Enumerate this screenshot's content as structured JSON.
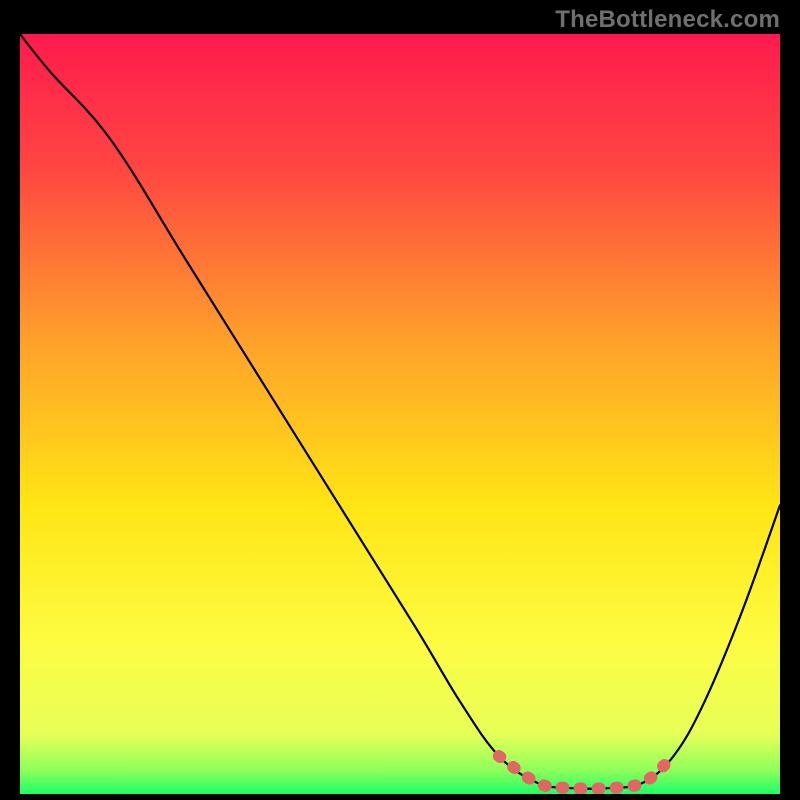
{
  "watermark": "TheBottleneck.com",
  "chart_data": {
    "type": "line",
    "title": "",
    "xlabel": "",
    "ylabel": "",
    "xlim": [
      0,
      100
    ],
    "ylim": [
      0,
      100
    ],
    "grid": false,
    "legend_position": "none",
    "gradient_stops": [
      {
        "offset": 0,
        "color": "#ff1a4d"
      },
      {
        "offset": 18,
        "color": "#ff4741"
      },
      {
        "offset": 40,
        "color": "#ff9f2b"
      },
      {
        "offset": 62,
        "color": "#ffe514"
      },
      {
        "offset": 80,
        "color": "#fdfc42"
      },
      {
        "offset": 92,
        "color": "#e8ff57"
      },
      {
        "offset": 97,
        "color": "#8bff5a"
      },
      {
        "offset": 100,
        "color": "#1cff66"
      }
    ],
    "series": [
      {
        "name": "bottleneck-curve",
        "color": "#000000",
        "points": [
          {
            "x": 0,
            "y": 100
          },
          {
            "x": 4,
            "y": 95
          },
          {
            "x": 12,
            "y": 86
          },
          {
            "x": 22,
            "y": 70
          },
          {
            "x": 32,
            "y": 54
          },
          {
            "x": 42,
            "y": 38
          },
          {
            "x": 52,
            "y": 22
          },
          {
            "x": 58,
            "y": 12
          },
          {
            "x": 63,
            "y": 5
          },
          {
            "x": 68,
            "y": 1.5
          },
          {
            "x": 72,
            "y": 0.8
          },
          {
            "x": 78,
            "y": 0.8
          },
          {
            "x": 82,
            "y": 1.5
          },
          {
            "x": 86,
            "y": 5
          },
          {
            "x": 90,
            "y": 12
          },
          {
            "x": 95,
            "y": 24
          },
          {
            "x": 100,
            "y": 38
          }
        ]
      },
      {
        "name": "optimal-band-marker",
        "color": "#e26664",
        "points": [
          {
            "x": 63,
            "y": 5
          },
          {
            "x": 68,
            "y": 1.5
          },
          {
            "x": 72,
            "y": 0.8
          },
          {
            "x": 78,
            "y": 0.8
          },
          {
            "x": 82,
            "y": 1.5
          },
          {
            "x": 85,
            "y": 4
          }
        ]
      }
    ]
  }
}
